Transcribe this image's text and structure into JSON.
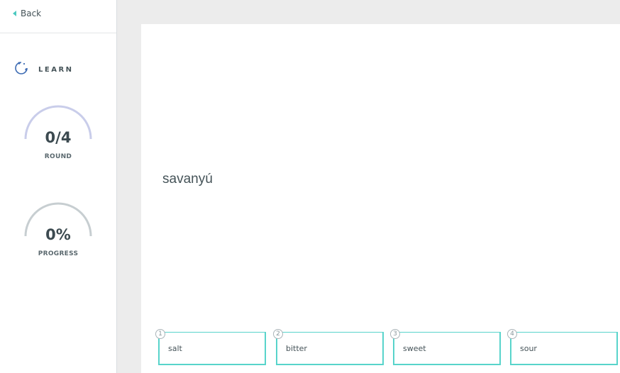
{
  "sidebar": {
    "back_label": "Back",
    "mode_label": "LEARN",
    "round": {
      "value": "0/4",
      "label": "ROUND",
      "fraction": 0
    },
    "progress": {
      "value": "0%",
      "label": "PROGRESS",
      "fraction": 0
    }
  },
  "main": {
    "term": "savanyú",
    "answers": [
      {
        "number": "1",
        "text": "salt"
      },
      {
        "number": "2",
        "text": "bitter"
      },
      {
        "number": "3",
        "text": "sweet"
      },
      {
        "number": "4",
        "text": "sour"
      }
    ]
  },
  "colors": {
    "accent": "#58d4cb",
    "round_arc": "#c9cdea",
    "progress_arc": "#c7ced1",
    "learn_icon": "#3d6bb3"
  }
}
